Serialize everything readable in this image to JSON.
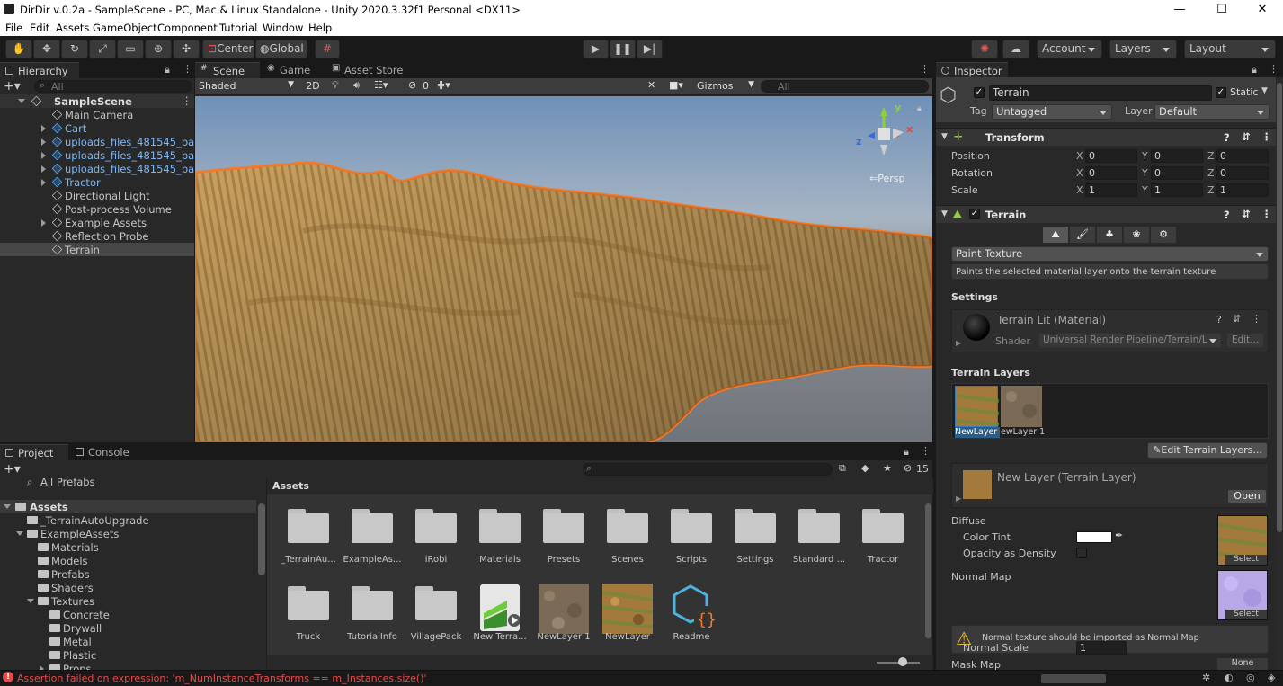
{
  "window": {
    "title": "DirDir v.0.2a - SampleScene - PC, Mac & Linux Standalone - Unity 2020.3.32f1 Personal <DX11>",
    "minimize": "—",
    "maximize": "☐",
    "close": "✕"
  },
  "menu": [
    "File",
    "Edit",
    "Assets",
    "GameObject",
    "Component",
    "Tutorial",
    "Window",
    "Help"
  ],
  "toolbar": {
    "center": "Center",
    "global": "Global",
    "account": "Account",
    "layers": "Layers",
    "layout": "Layout"
  },
  "hierarchy": {
    "tab": "Hierarchy",
    "search": "All",
    "scene": "SampleScene",
    "items": [
      "Main Camera",
      "Cart",
      "uploads_files_481545_bark",
      "uploads_files_481545_bark",
      "uploads_files_481545_bark",
      "Tractor",
      "Directional Light",
      "Post-process Volume",
      "Example Assets",
      "Reflection Probe",
      "Terrain"
    ]
  },
  "scene_view": {
    "tabs": [
      "Scene",
      "Game",
      "Asset Store"
    ],
    "shading": "Shaded",
    "mode2d": "2D",
    "hidden_count": "0",
    "gizmos": "Gizmos",
    "search": "All",
    "persp": "Persp",
    "axis_x": "x",
    "axis_y": "y",
    "axis_z": "z"
  },
  "project": {
    "tabs": [
      "Project",
      "Console"
    ],
    "hidden_count": "15",
    "all_prefabs": "All Prefabs",
    "tree": [
      "Assets",
      "_TerrainAutoUpgrade",
      "ExampleAssets",
      "Materials",
      "Models",
      "Prefabs",
      "Shaders",
      "Textures",
      "Concrete",
      "Drywall",
      "Metal",
      "Plastic",
      "Props"
    ],
    "breadcrumb": "Assets",
    "assets": [
      "_TerrainAu...",
      "ExampleAs...",
      "iRobi",
      "Materials",
      "Presets",
      "Scenes",
      "Scripts",
      "Settings",
      "Standard ...",
      "Tractor",
      "Truck",
      "TutorialInfo",
      "VillagePack",
      "New Terra...",
      "NewLayer 1",
      "NewLayer",
      "Readme"
    ]
  },
  "inspector": {
    "tab": "Inspector",
    "object_name": "Terrain",
    "static": "Static",
    "tag_label": "Tag",
    "tag": "Untagged",
    "layer_label": "Layer",
    "layer": "Default",
    "transform": {
      "title": "Transform",
      "rows": [
        {
          "label": "Position",
          "x": "0",
          "y": "0",
          "z": "0"
        },
        {
          "label": "Rotation",
          "x": "0",
          "y": "0",
          "z": "0"
        },
        {
          "label": "Scale",
          "x": "1",
          "y": "1",
          "z": "1"
        }
      ]
    },
    "terrain": {
      "title": "Terrain",
      "tool": "Paint Texture",
      "tool_help": "Paints the selected material layer onto the terrain texture",
      "settings": "Settings",
      "material": "Terrain Lit (Material)",
      "shader_label": "Shader",
      "shader": "Universal Render Pipeline/Terrain/L",
      "edit": "Edit...",
      "layers_title": "Terrain Layers",
      "layer1": "NewLayer",
      "layer2": "ewLayer 1",
      "edit_layers": "Edit Terrain Layers...",
      "layer_name": "New Layer (Terrain Layer)",
      "open": "Open",
      "diffuse": "Diffuse",
      "color_tint": "Color Tint",
      "opacity": "Opacity as Density",
      "select": "Select",
      "normal_map": "Normal Map",
      "warning": "Normal texture should be imported as Normal Map",
      "normal_scale": "Normal Scale",
      "normal_scale_value": "1",
      "mask_map": "Mask Map",
      "none": "None"
    }
  },
  "status": {
    "error": "Assertion failed on expression: 'm_NumInstanceTransforms == m_Instances.size()'"
  },
  "colors": {
    "accent": "#3a79bb",
    "selection": "#2c5d87",
    "error": "#e84a4a",
    "terrain_outline": "#f07c2c"
  }
}
